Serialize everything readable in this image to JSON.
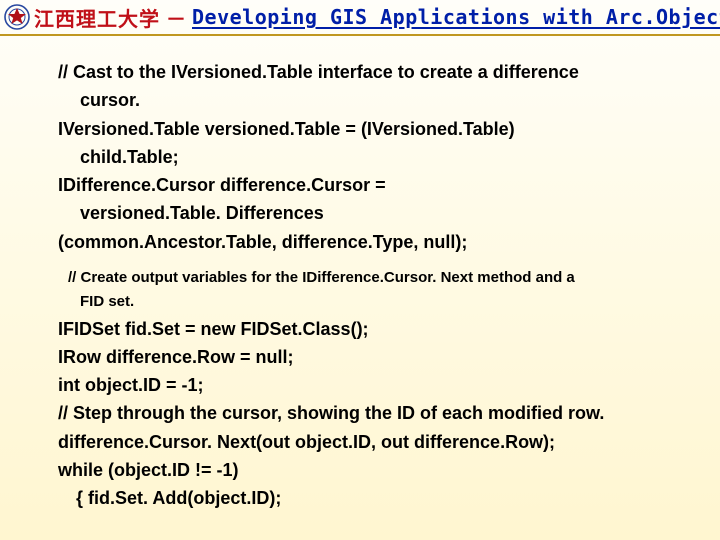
{
  "header": {
    "university": "江西理工大学",
    "dash": "－",
    "course": "Developing GIS Applications with Arc.Objects using C#. NE"
  },
  "code": {
    "l1a": "// Cast to the IVersioned.Table interface to create a difference",
    "l1b": "cursor.",
    "l2a": "IVersioned.Table versioned.Table = (IVersioned.Table)",
    "l2b": "child.Table;",
    "l3a": "IDifference.Cursor difference.Cursor =",
    "l3b": "versioned.Table. Differences",
    "l4": "(common.Ancestor.Table, difference.Type, null);",
    "l5a": "// Create output variables for the IDifference.Cursor. Next method and a",
    "l5b": "FID set.",
    "l6": "IFIDSet fid.Set = new FIDSet.Class();",
    "l7": "IRow difference.Row = null;",
    "l8": "int object.ID = -1;",
    "l9": "// Step through the cursor, showing the ID of each modified row.",
    "l10": "difference.Cursor. Next(out object.ID, out difference.Row);",
    "l11": " while (object.ID != -1)",
    "l12": "  {   fid.Set. Add(object.ID);"
  }
}
